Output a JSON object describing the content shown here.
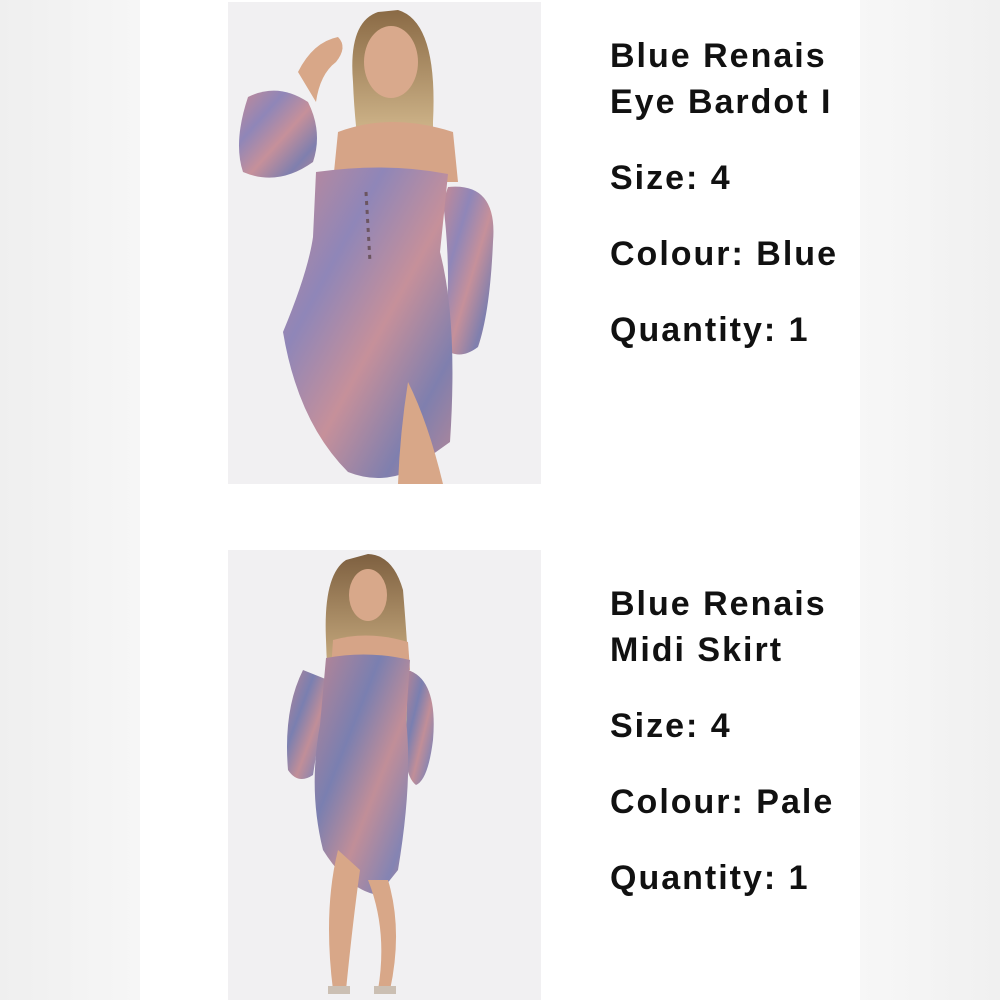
{
  "items": [
    {
      "title_line1": "Blue Renais",
      "title_line2": "Eye Bardot I",
      "size": "Size: 4",
      "colour": "Colour: Blue",
      "quantity": "Quantity: 1",
      "image_icon": "product-photo-dress-icon"
    },
    {
      "title_line1": "Blue Renais",
      "title_line2": "Midi Skirt",
      "size": "Size: 4",
      "colour": "Colour: Pale",
      "quantity": "Quantity: 1",
      "image_icon": "product-photo-skirt-icon"
    }
  ],
  "colors": {
    "panel": "#ffffff",
    "background": "#f4f4f4",
    "text": "#111111",
    "print_pink": "#b98594",
    "print_blue": "#7a7fb0"
  }
}
